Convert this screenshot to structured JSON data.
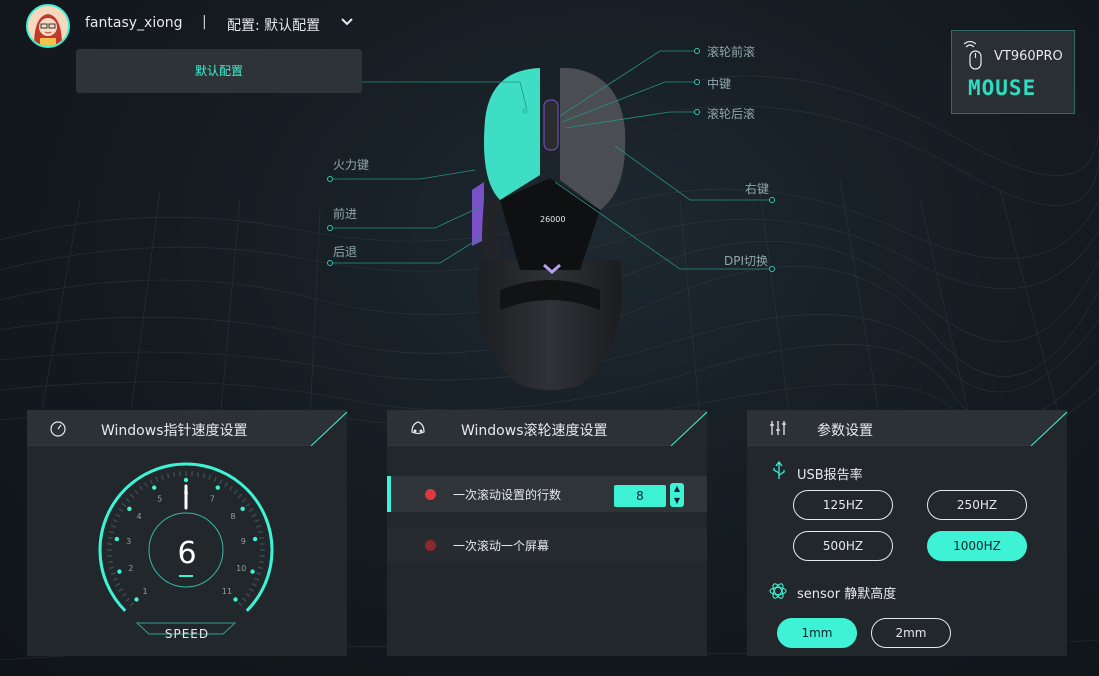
{
  "header": {
    "username": "fantasy_xiong",
    "separator": "|",
    "config_label": "配置: 默认配置",
    "dropdown_items": [
      "默认配置"
    ]
  },
  "device": {
    "name": "VT960PRO",
    "logo_text": "MOUSE",
    "icon": "wireless-mouse-icon"
  },
  "mouse_buttons": {
    "scroll_forward": "滚轮前滚",
    "middle": "中键",
    "scroll_back": "滚轮后滚",
    "fire": "火力键",
    "forward": "前进",
    "back": "后退",
    "right": "右键",
    "dpi": "DPI切换"
  },
  "mouse_screen": {
    "dpi_value": "26000"
  },
  "pointer_panel": {
    "title": "Windows指针速度设置",
    "icon": "speedometer-icon",
    "speed_value": "6",
    "speed_level": 6,
    "speed_max": 11,
    "label": "SPEED",
    "ticks": [
      "1",
      "2",
      "3",
      "4",
      "5",
      "6",
      "7",
      "8",
      "9",
      "10",
      "11"
    ]
  },
  "scroll_panel": {
    "title": "Windows滚轮速度设置",
    "icon": "scroll-wheel-icon",
    "option_lines": "一次滚动设置的行数",
    "lines_value": "8",
    "option_screen": "一次滚动一个屏幕"
  },
  "params_panel": {
    "title": "参数设置",
    "icon": "sliders-icon",
    "usb_label": "USB报告率",
    "usb_icon": "usb-icon",
    "rates": [
      "125HZ",
      "250HZ",
      "500HZ",
      "1000HZ"
    ],
    "selected_rate": "1000HZ",
    "sensor_label": "sensor 静默高度",
    "sensor_icon": "sensor-atom-icon",
    "heights": [
      "1mm",
      "2mm"
    ],
    "selected_height": "1mm"
  },
  "colors": {
    "accent": "#3ef2d6",
    "panel": "#22272c",
    "background": "#141a20",
    "radio_active": "#e0383f",
    "radio_inactive": "#8a2a2e"
  }
}
